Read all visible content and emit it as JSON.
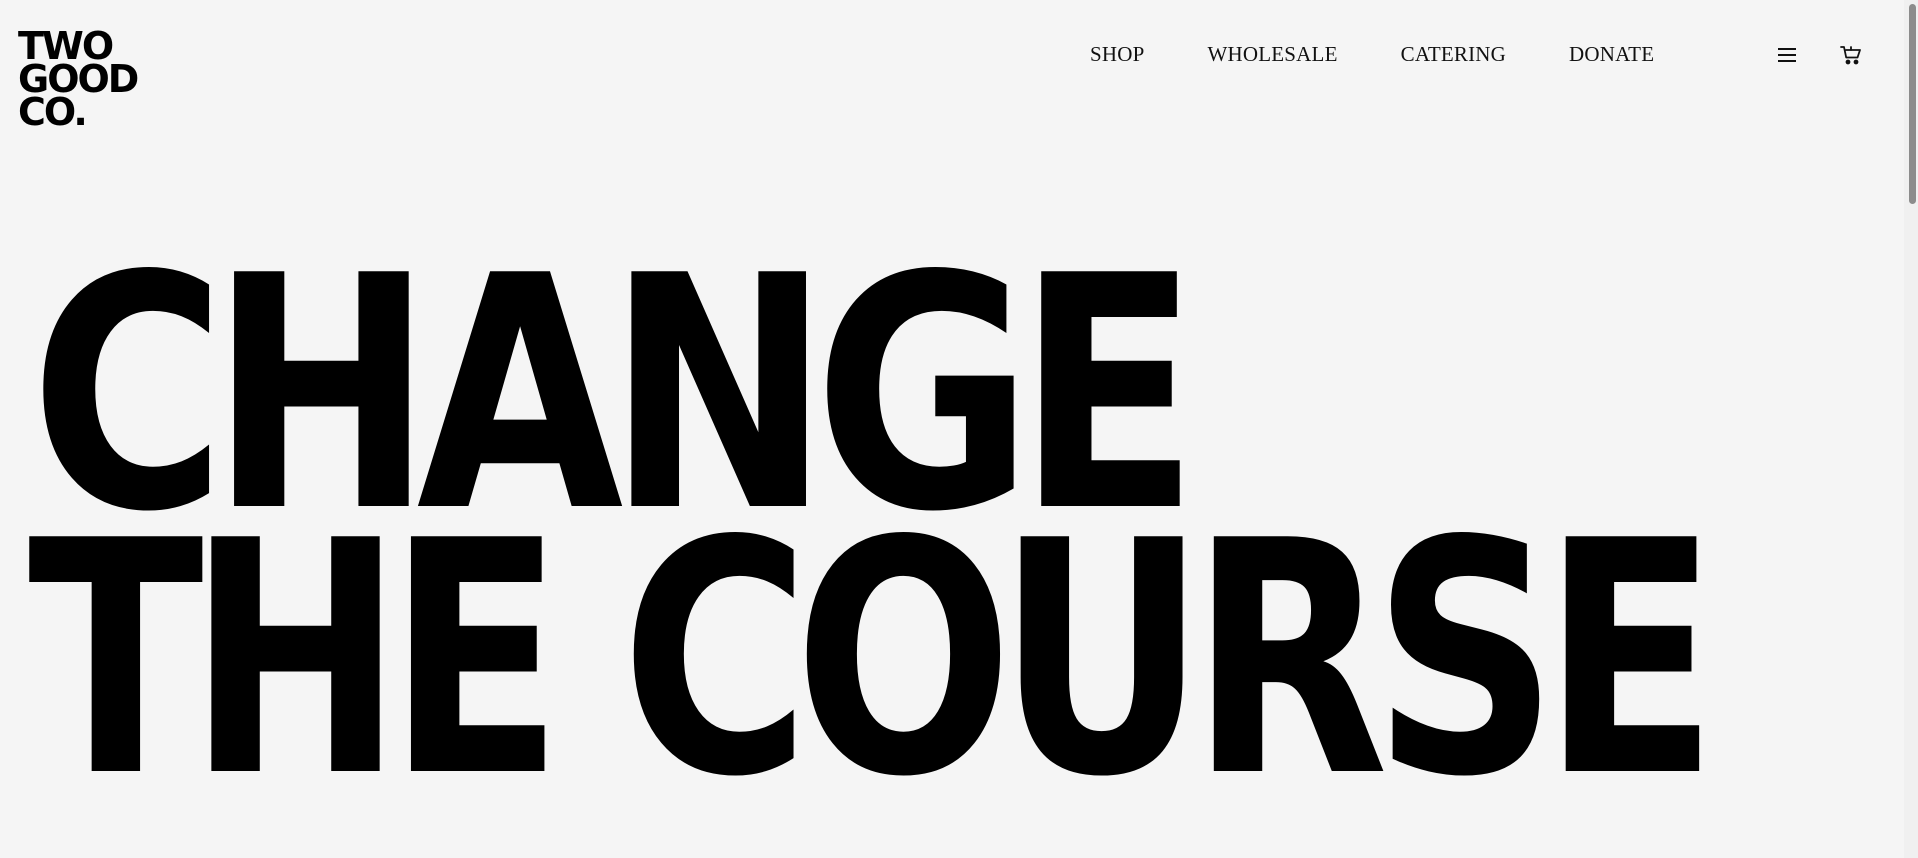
{
  "logo": {
    "line1": "TWO",
    "line2": "GOOD",
    "line3": "CO."
  },
  "nav": {
    "items": [
      {
        "label": "SHOP"
      },
      {
        "label": "WHOLESALE"
      },
      {
        "label": "CATERING"
      },
      {
        "label": "DONATE"
      }
    ],
    "menu_icon": "hamburger-menu-icon",
    "cart_icon": "shopping-cart-icon"
  },
  "hero": {
    "line1": "CHANGE",
    "line2": "THE COURSE"
  },
  "colors": {
    "background": "#f5f5f5",
    "text": "#000000"
  }
}
